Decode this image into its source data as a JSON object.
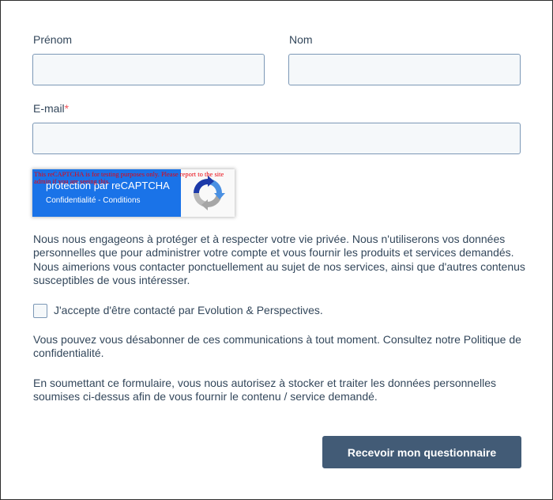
{
  "form": {
    "first_name": {
      "label": "Prénom",
      "value": ""
    },
    "last_name": {
      "label": "Nom",
      "value": ""
    },
    "email": {
      "label": "E-mail",
      "required_marker": "*",
      "value": ""
    },
    "recaptcha": {
      "testing_notice": "This reCAPTCHA is for testing purposes only. Please report to the site admin if you are seeing this.",
      "title": "protection par reCAPTCHA",
      "links": "Confidentialité - Conditions",
      "brand_color": "#1a73e8",
      "icon": "recaptcha-logo-icon"
    },
    "privacy_text": "Nous nous engageons à protéger et à respecter votre vie privée. Nous n'utiliserons vos données personnelles que pour administrer votre compte et vous fournir les produits et services demandés. Nous aimerions vous contacter ponctuellement au sujet de nos services, ainsi que d'autres contenus susceptibles de vous intéresser.",
    "consent_checkbox": {
      "label": "J'accepte d'être contacté par Evolution & Perspectives.",
      "checked": false
    },
    "unsubscribe_text": "Vous pouvez vous désabonner de ces communications à tout moment. Consultez notre Politique de confidentialité.",
    "submit_notice": "En soumettant ce formulaire, vous nous autorisez à stocker et traiter les données personnelles soumises ci-dessus afin de vous fournir le contenu / service demandé.",
    "submit_label": "Recevoir mon questionnaire"
  },
  "colors": {
    "text": "#33475b",
    "required": "#f2545b",
    "input_bg": "#f5f8fa",
    "input_border": "#7c98b6",
    "button_bg": "#425b76"
  }
}
